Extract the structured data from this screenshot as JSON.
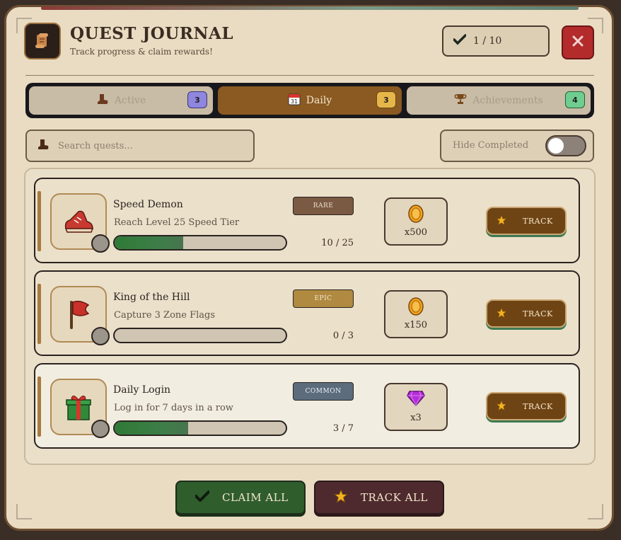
{
  "header": {
    "title": "QUEST JOURNAL",
    "subtitle": "Track progress & claim rewards!",
    "icon": "scroll-icon",
    "progress_text": "1 / 10",
    "close_icon": "close-icon"
  },
  "tabs": [
    {
      "label": "Active",
      "badge": "3",
      "icon": "boot-icon",
      "active": false,
      "badge_color": "#8f86e0"
    },
    {
      "label": "Daily",
      "badge": "3",
      "icon": "calendar-icon",
      "calendar_day": "31",
      "active": true,
      "badge_color": "#e7b64a"
    },
    {
      "label": "Achievements",
      "badge": "4",
      "icon": "trophy-icon",
      "active": false,
      "badge_color": "#6fce8f"
    }
  ],
  "search": {
    "placeholder": "Search quests...",
    "value": ""
  },
  "filter": {
    "label": "Hide Completed",
    "enabled": false
  },
  "quests": [
    {
      "name": "Speed Demon",
      "description": "Reach Level 25 Speed Tier",
      "rarity": "RARE",
      "rarity_color": "#7a5a43",
      "rarity_text_color": "#eedfc8",
      "progress": "10 / 25",
      "progress_fraction": 0.4,
      "reward_amount": "x500",
      "reward_icon": "coin-icon",
      "icon": "sneaker-icon",
      "button": "TRACK"
    },
    {
      "name": "King of the Hill",
      "description": "Capture 3 Zone Flags",
      "rarity": "EPIC",
      "rarity_color": "#b08a40",
      "rarity_text_color": "#f4e6cc",
      "progress": "0 / 3",
      "progress_fraction": 0,
      "reward_amount": "x150",
      "reward_icon": "coin-icon",
      "icon": "flag-icon",
      "button": "TRACK"
    },
    {
      "name": "Daily Login",
      "description": "Log in for 7 days in a row",
      "rarity": "COMMON",
      "rarity_color": "#5c6c7d",
      "rarity_text_color": "#eef2f6",
      "progress": "3 / 7",
      "progress_fraction": 0.43,
      "reward_amount": "x3",
      "reward_icon": "gem-icon",
      "icon": "gift-icon",
      "button": "TRACK"
    }
  ],
  "footer": {
    "claim_label": "CLAIM ALL",
    "track_label": "TRACK ALL"
  },
  "colors": {
    "panel": "#e9dcc2",
    "accent_brown": "#8a5a22",
    "claim_green": "#2f5d2c",
    "close_red": "#b32b2b"
  }
}
